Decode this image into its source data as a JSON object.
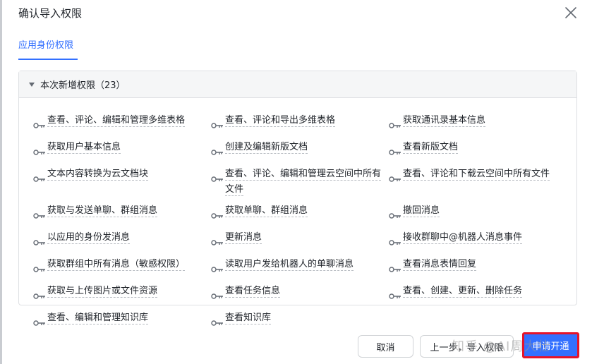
{
  "dialog": {
    "title": "确认导入权限"
  },
  "tabs": [
    {
      "label": "应用身份权限",
      "active": true
    }
  ],
  "panel": {
    "title": "本次新增权限（23）"
  },
  "permissions": [
    "查看、评论、编辑和管理多维表格",
    "查看、评论和导出多维表格",
    "获取通讯录基本信息",
    "获取用户基本信息",
    "创建及编辑新版文档",
    "查看新版文档",
    "文本内容转换为云文档块",
    "查看、评论、编辑和管理云空间中所有文件",
    "查看、评论和下载云空间中所有文件",
    "获取与发送单聊、群组消息",
    "获取单聊、群组消息",
    "撤回消息",
    "以应用的身份发消息",
    "更新消息",
    "接收群聊中@机器人消息事件",
    "获取群组中所有消息（敏感权限）",
    "读取用户发给机器人的单聊消息",
    "查看消息表情回复",
    "获取与上传图片或文件资源",
    "查看任务信息",
    "查看、创建、更新、删除任务",
    "查看、编辑和管理知识库",
    "查看知识库"
  ],
  "footer": {
    "cancel_label": "取消",
    "prev_label": "上一步，导入权限",
    "apply_label": "申请开通"
  },
  "watermark": "知乎 @AI周大壮",
  "colors": {
    "accent": "#3370ff",
    "highlight_border": "#e5142a"
  },
  "icons": {
    "close": "close-icon",
    "caret": "caret-down-icon",
    "key": "key-icon"
  }
}
